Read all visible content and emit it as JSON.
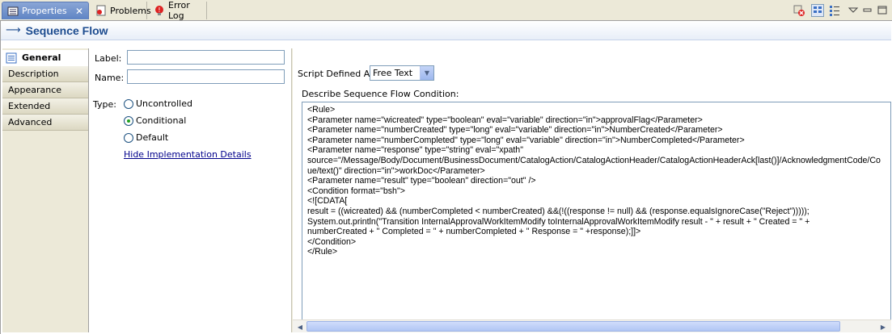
{
  "tabs": {
    "properties": "Properties",
    "problems": "Problems",
    "error_log": "Error Log",
    "close_glyph": "✕"
  },
  "header": {
    "title": "Sequence Flow",
    "arrow": "⟶"
  },
  "sidebar": {
    "items": [
      {
        "label": "General",
        "active": true
      },
      {
        "label": "Description"
      },
      {
        "label": "Appearance"
      },
      {
        "label": "Extended"
      },
      {
        "label": "Advanced"
      }
    ]
  },
  "form": {
    "label_field": {
      "label": "Label:",
      "value": ""
    },
    "name_field": {
      "label": "Name:",
      "value": ""
    },
    "type": {
      "label": "Type:",
      "options": [
        {
          "label": "Uncontrolled",
          "selected": false
        },
        {
          "label": "Conditional",
          "selected": true
        },
        {
          "label": "Default",
          "selected": false
        }
      ]
    },
    "hide_link": "Hide Implementation Details"
  },
  "right": {
    "script_label": "Script Defined As:",
    "script_value": "Free Text",
    "condition_label": "Describe Sequence Flow Condition:",
    "condition_lines": [
      "<Rule>",
      "<Parameter name=\"wicreated\" type=\"boolean\" eval=\"variable\" direction=\"in\">approvalFlag</Parameter>",
      "<Parameter name=\"numberCreated\" type=\"long\" eval=\"variable\" direction=\"in\">NumberCreated</Parameter>",
      "<Parameter name=\"numberCompleted\" type=\"long\" eval=\"variable\" direction=\"in\">NumberCompleted</Parameter>",
      "<Parameter name=\"response\" type=\"string\" eval=\"xpath\"",
      "source=\"/Message/Body/Document/BusinessDocument/CatalogAction/CatalogActionHeader/CatalogActionHeaderAck[last()]/AcknowledgmentCode/Co",
      "ue/text()\" direction=\"in\">workDoc</Parameter>",
      "<Parameter name=\"result\" type=\"boolean\" direction=\"out\" />",
      "<Condition format=\"bsh\">",
      "<![CDATA[",
      "result = ((wicreated) && (numberCompleted < numberCreated) &&(!((response != null) && (response.equalsIgnoreCase(\"Reject\")))));",
      "System.out.println(\"Transition InternalApprovalWorkItemModify toInternalApprovalWorkItemModify result - \" + result + \" Created = \" +",
      "numberCreated + \" Completed = \" + numberCompleted + \" Response = \" +response);]]>",
      "</Condition>",
      "</Rule>"
    ]
  },
  "colors": {
    "active_tab": "#6f8fcc",
    "title_text": "#1d4c8f",
    "link": "#00008b",
    "radio_on": "#21a121"
  }
}
